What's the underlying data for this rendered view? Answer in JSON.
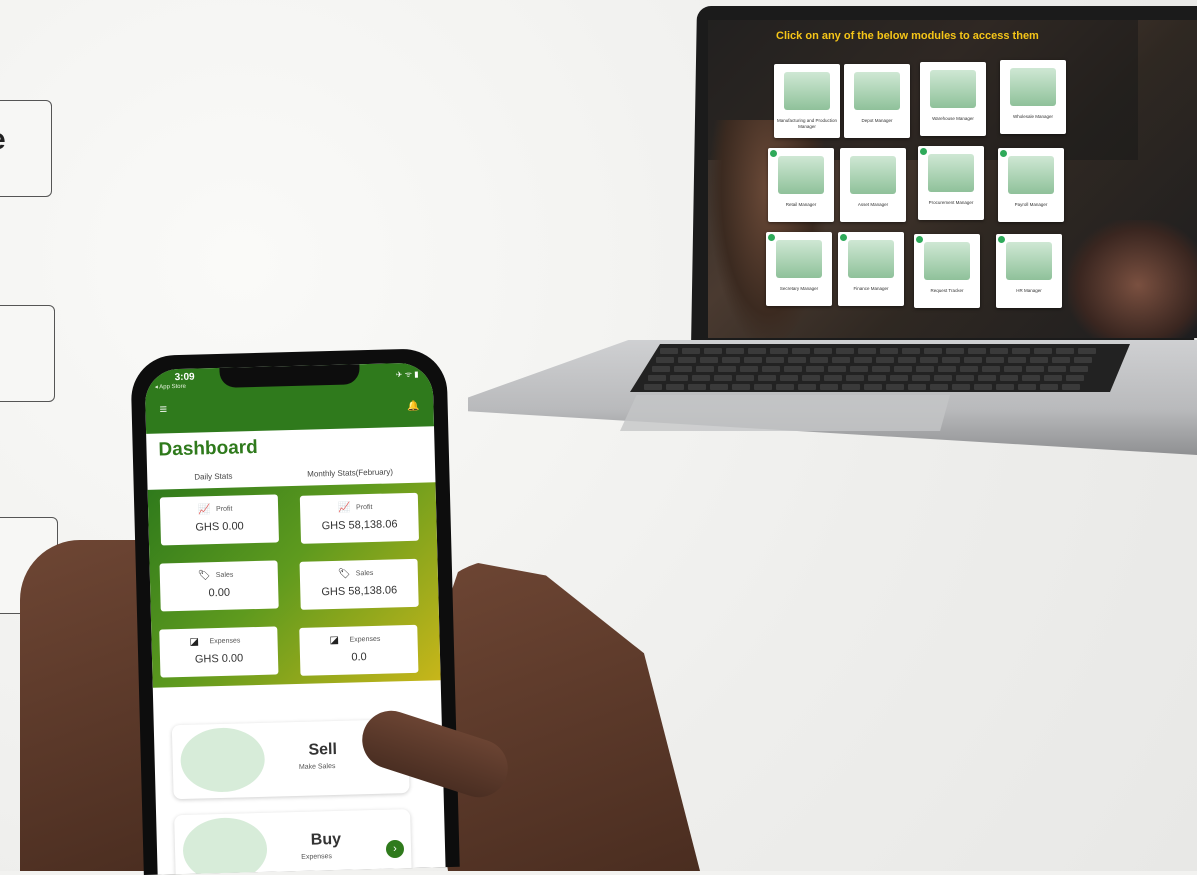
{
  "left_boxes": [
    {
      "text": "e"
    }
  ],
  "laptop": {
    "title": "Click on any of the below modules to access them",
    "modules": [
      {
        "label": "Manufacturing and Production Manager",
        "checked": false
      },
      {
        "label": "Depot Manager",
        "checked": false
      },
      {
        "label": "Warehouse Manager",
        "checked": false
      },
      {
        "label": "Wholesale Manager",
        "checked": false
      },
      {
        "label": "Retail Manager",
        "checked": true
      },
      {
        "label": "Asset Manager",
        "checked": false
      },
      {
        "label": "Procurement Manager",
        "checked": true
      },
      {
        "label": "Payroll Manager",
        "checked": true
      },
      {
        "label": "Secretary Manager",
        "checked": true
      },
      {
        "label": "Finance Manager",
        "checked": true
      },
      {
        "label": "Request Tracker",
        "checked": true
      },
      {
        "label": "HR Manager",
        "checked": true
      }
    ]
  },
  "phone": {
    "status": {
      "time": "3:09",
      "back_label": "◂ App Store",
      "icons": "✈ ᯤ ▮"
    },
    "menu_icon": "≡",
    "bell_icon": "🔔",
    "title": "Dashboard",
    "daily_label": "Daily Stats",
    "monthly_label": "Monthly Stats(February)",
    "daily": {
      "profit_label": "Profit",
      "profit_value": "GHS 0.00",
      "sales_label": "Sales",
      "sales_value": "0.00",
      "expenses_label": "Expenses",
      "expenses_value": "GHS 0.00"
    },
    "monthly": {
      "profit_label": "Profit",
      "profit_value": "GHS 58,138.06",
      "sales_label": "Sales",
      "sales_value": "GHS 58,138.06",
      "expenses_label": "Expenses",
      "expenses_value": "0.0"
    },
    "sell": {
      "title": "Sell",
      "subtitle": "Make Sales"
    },
    "buy": {
      "title": "Buy",
      "subtitle": "Expenses"
    },
    "arrow_icon": "›"
  },
  "colors": {
    "primary_green": "#2f7a1c",
    "accent_yellow": "#c8b61a",
    "screen_title": "#f5c518"
  }
}
